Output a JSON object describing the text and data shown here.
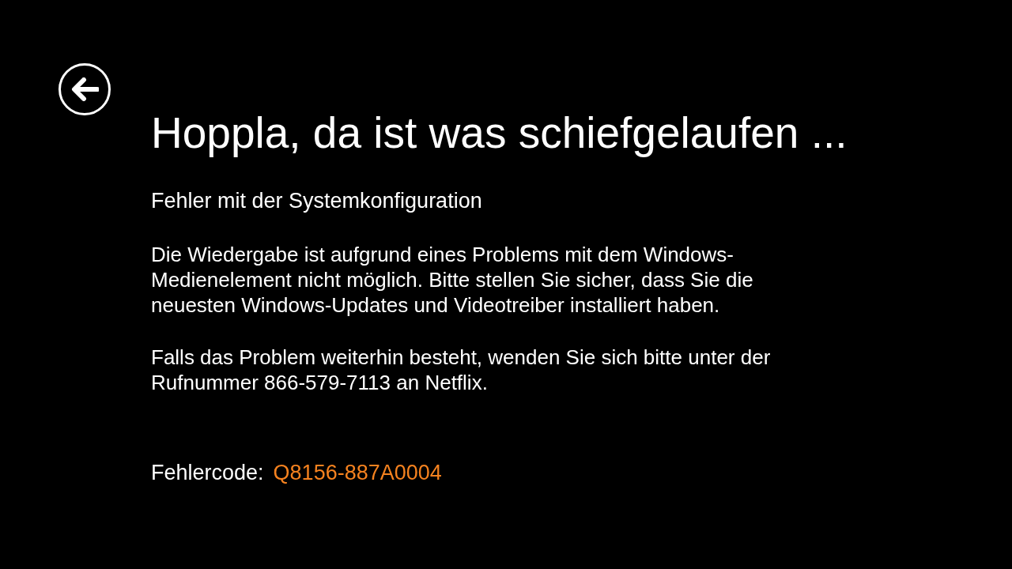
{
  "title": "Hoppla, da ist was schiefgelaufen ...",
  "subtitle": "Fehler mit der Systemkonfiguration",
  "paragraphs": [
    "Die Wiedergabe ist aufgrund eines Problems mit dem Windows-Medienelement nicht möglich. Bitte stellen Sie sicher, dass Sie die neuesten Windows-Updates und Videotreiber installiert haben.",
    "Falls das Problem weiterhin besteht, wenden Sie sich bitte unter der Rufnummer 866-579-7113 an Netflix."
  ],
  "error_code": {
    "label": "Fehlercode:",
    "value": "Q8156-887A0004"
  }
}
